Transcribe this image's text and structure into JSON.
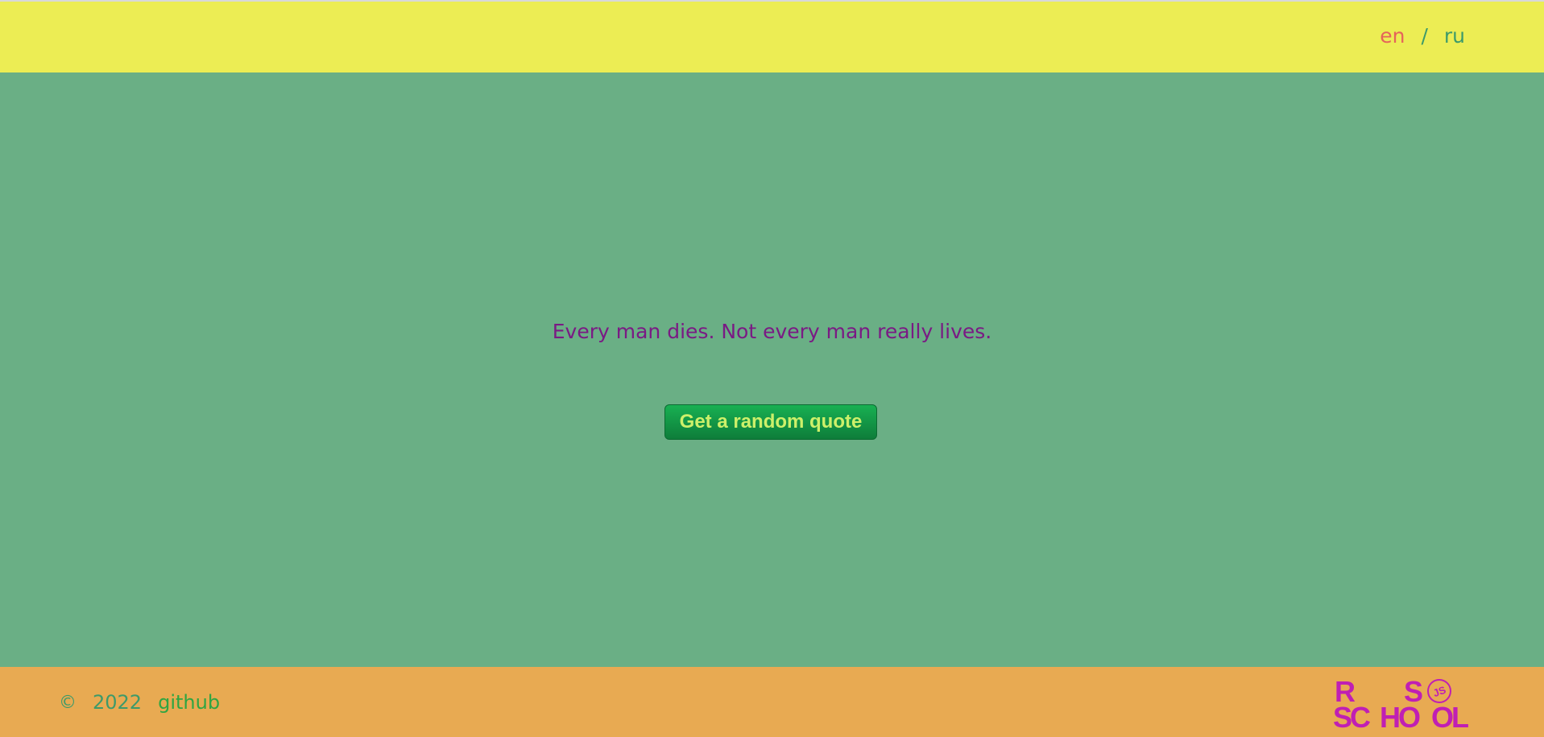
{
  "colors": {
    "header_bg": "#eced54",
    "main_bg": "#6aaf85",
    "footer_bg": "#e8aa52",
    "quote_text": "#7a1a84",
    "button_bg": "#18b052",
    "button_text": "#cdf06a",
    "lang_active": "#e5645a",
    "lang_inactive": "#3d9a6a",
    "logo": "#c01fb4"
  },
  "header": {
    "lang_en": "en",
    "lang_separator": "/",
    "lang_ru": "ru"
  },
  "main": {
    "quote": "Every man dies. Not every man really lives.",
    "button_label": "Get a random quote"
  },
  "footer": {
    "copyright_symbol": "©",
    "year": "2022",
    "github_link": "github",
    "logo": {
      "icon": "rs-school-js-logo",
      "text": "RS SCHOOL JS"
    }
  }
}
